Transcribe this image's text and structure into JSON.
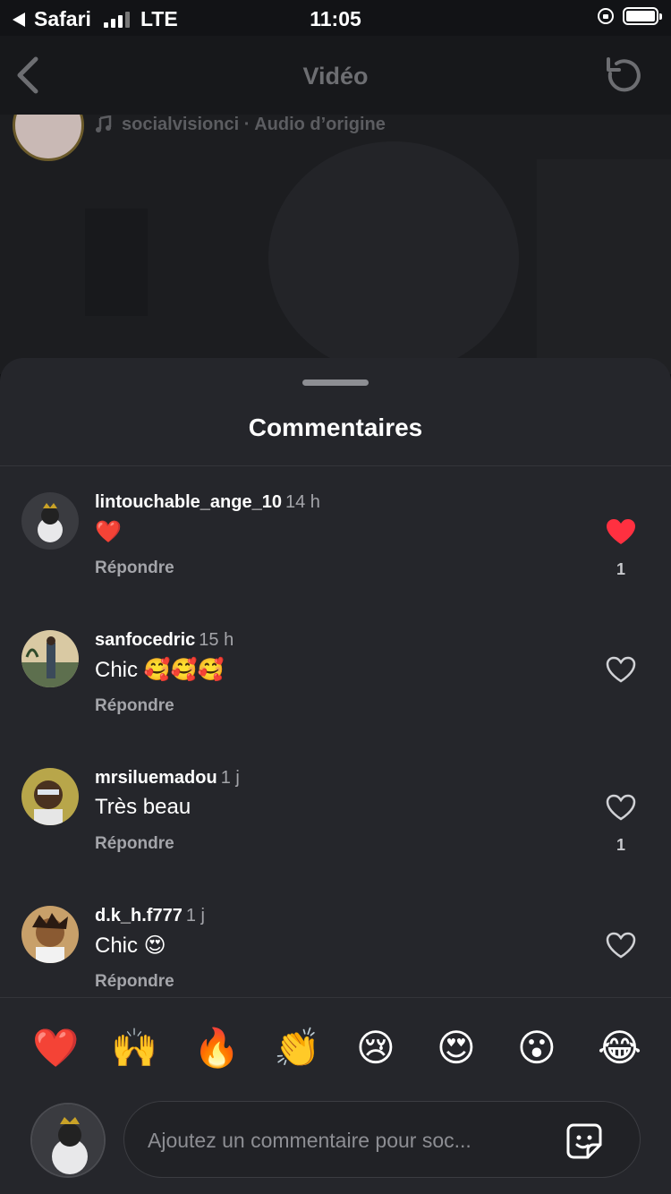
{
  "status": {
    "carrier": "Safari",
    "network": "LTE",
    "time": "11:05"
  },
  "nav": {
    "title": "Vidéo"
  },
  "video": {
    "audio_label": "socialvisionci · Audio d’origine"
  },
  "sheet": {
    "title": "Commentaires"
  },
  "comments": [
    {
      "user": "lintouchable_ange_10",
      "time": "14 h",
      "text": "❤️",
      "reply": "Répondre",
      "liked": true,
      "likes": "1"
    },
    {
      "user": "sanfocedric",
      "time": "15 h",
      "text": "Chic 🥰🥰🥰",
      "reply": "Répondre",
      "liked": false,
      "likes": ""
    },
    {
      "user": "mrsiluemadou",
      "time": "1 j",
      "text": "Très beau",
      "reply": "Répondre",
      "liked": false,
      "likes": "1"
    },
    {
      "user": "d.k_h.f777",
      "time": "1 j",
      "text": "Chic 😍",
      "reply": "Répondre",
      "liked": false,
      "likes": ""
    }
  ],
  "emoji_bar": [
    "❤️",
    "🙌",
    "🔥",
    "👏",
    "😢",
    "😍",
    "😮",
    "😂"
  ],
  "composer": {
    "placeholder": "Ajoutez un commentaire pour soc..."
  },
  "colors": {
    "like_red": "#ff3040",
    "background": "#25262b",
    "muted_text": "#a4a5aa"
  }
}
